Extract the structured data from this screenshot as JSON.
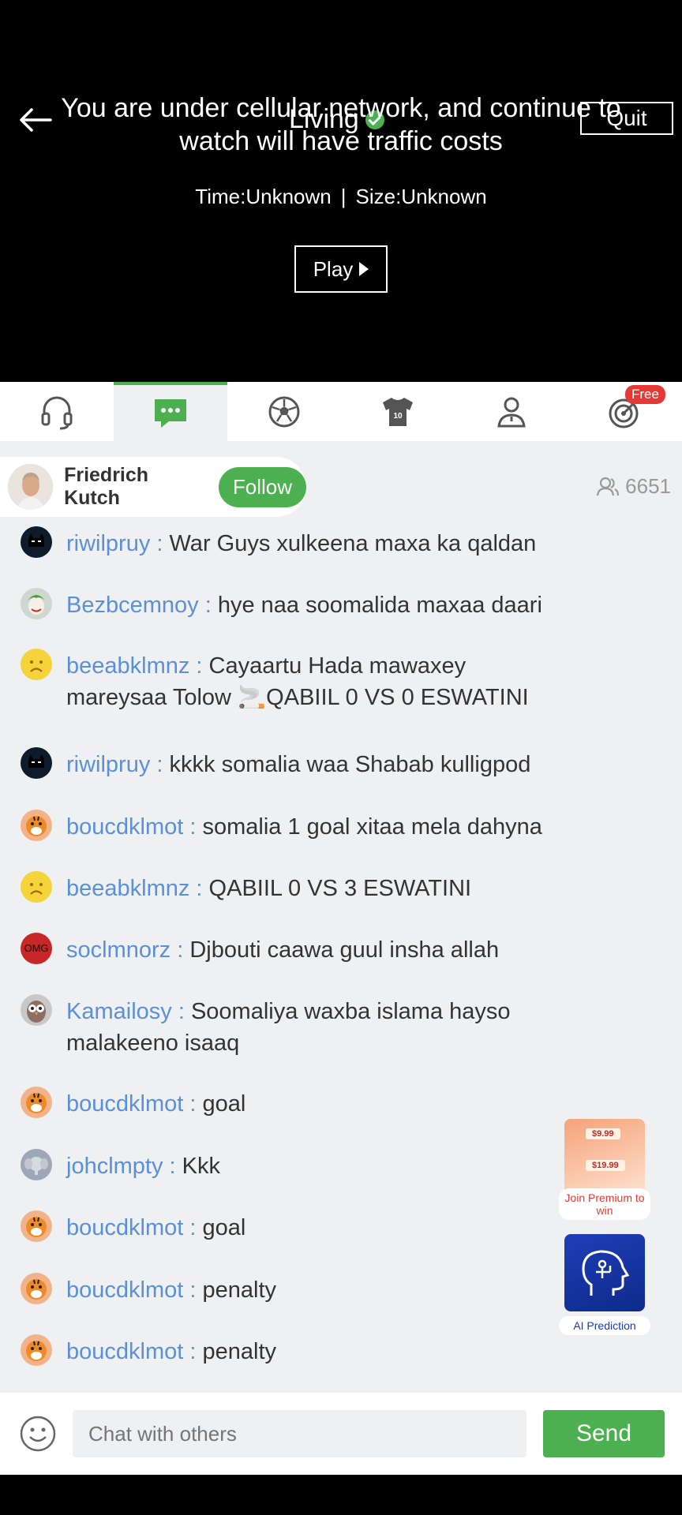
{
  "video": {
    "title": "Living",
    "quit_label": "Quit",
    "warning": "You are under cellular network, and continue to watch will have traffic costs",
    "time": "Time:Unknown",
    "size": "Size:Unknown",
    "separator": "|",
    "play_label": "Play"
  },
  "tabs": [
    {
      "icon": "headset-icon"
    },
    {
      "icon": "chat-icon",
      "active": true
    },
    {
      "icon": "soccer-ball-icon"
    },
    {
      "icon": "jersey-icon",
      "number": "10"
    },
    {
      "icon": "person-icon"
    },
    {
      "icon": "target-icon",
      "badge": "Free"
    }
  ],
  "host": {
    "name": "Friedrich Kutch",
    "follow_label": "Follow",
    "viewers": "6651"
  },
  "messages": [
    {
      "user": "riwilpruy",
      "sep": " : ",
      "text": "War Guys xulkeena maxa ka qaldan",
      "avatar": "batman"
    },
    {
      "user": "Bezbcemnoy",
      "sep": " : ",
      "text": "hye naa soomalida maxaa daari",
      "avatar": "joker"
    },
    {
      "user": "beeabklmnz",
      "sep": " : ",
      "text": "Cayaartu Hada mawaxey mareysaa Tolow 🚬QABIIL 0 VS 0 ESWATINI",
      "avatar": "sad-face"
    },
    {
      "user": "riwilpruy",
      "sep": " : ",
      "text": "kkkk somalia waa Shabab kulligpod",
      "avatar": "batman"
    },
    {
      "user": "boucdklmot",
      "sep": " : ",
      "text": "somalia 1 goal xitaa mela dahyna",
      "avatar": "tiger"
    },
    {
      "user": "beeabklmnz",
      "sep": " : ",
      "text": "QABIIL 0 VS 3 ESWATINI",
      "avatar": "sad-face"
    },
    {
      "user": "soclmnorz",
      "sep": " : ",
      "text": "Djbouti caawa guul insha allah",
      "avatar": "omg",
      "avatar_text": "OMG"
    },
    {
      "user": "Kamailosy",
      "sep": " : ",
      "text": "Soomaliya waxba islama hayso malakeeno isaaq",
      "avatar": "owl"
    },
    {
      "user": "boucdklmot",
      "sep": " : ",
      "text": "goal",
      "avatar": "tiger"
    },
    {
      "user": "johclmpty",
      "sep": " : ",
      "text": "Kkk",
      "avatar": "elephant"
    },
    {
      "user": "boucdklmot",
      "sep": " : ",
      "text": "goal",
      "avatar": "tiger"
    },
    {
      "user": "boucdklmot",
      "sep": " : ",
      "text": "penalty",
      "avatar": "tiger"
    },
    {
      "user": "boucdklmot",
      "sep": " : ",
      "text": "penalty",
      "avatar": "tiger"
    }
  ],
  "promos": [
    {
      "label": "Join Premium to win",
      "price1": "$9.99",
      "price2": "$19.99"
    },
    {
      "label": "AI Prediction"
    }
  ],
  "input": {
    "placeholder": "Chat with others",
    "send_label": "Send"
  },
  "colors": {
    "accent": "#4caf50",
    "username": "#5b8fd6",
    "badge": "#e53935"
  }
}
